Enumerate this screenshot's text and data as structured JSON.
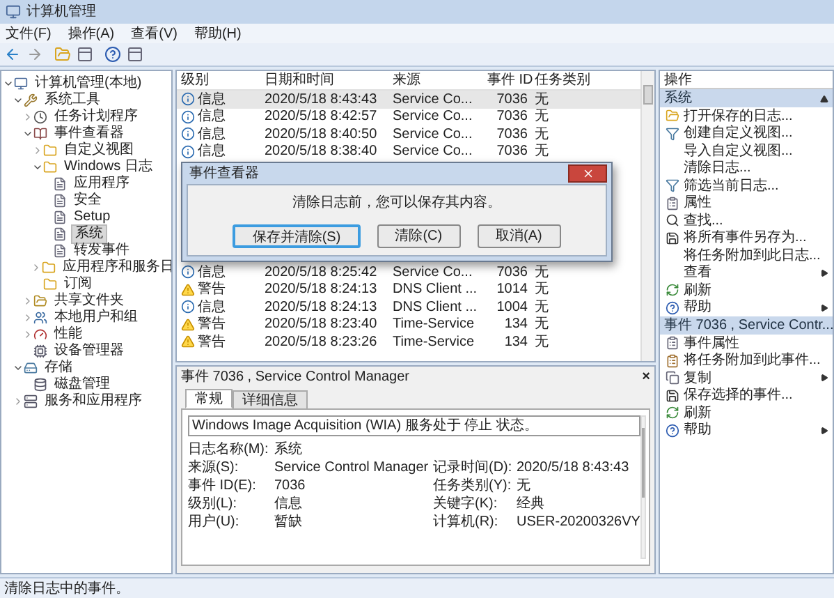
{
  "window": {
    "title": "计算机管理"
  },
  "menu": [
    "文件(F)",
    "操作(A)",
    "查看(V)",
    "帮助(H)"
  ],
  "tree": [
    {
      "label": "计算机管理(本地)",
      "kind": "computer",
      "expanded": true,
      "selected": false,
      "children": [
        {
          "label": "系统工具",
          "kind": "tools",
          "expanded": true,
          "selected": false,
          "children": [
            {
              "label": "任务计划程序",
              "kind": "clock",
              "expanded": false,
              "selected": false
            },
            {
              "label": "事件查看器",
              "kind": "viewer",
              "expanded": true,
              "selected": false,
              "children": [
                {
                  "label": "自定义视图",
                  "kind": "folder",
                  "expanded": false,
                  "selected": false
                },
                {
                  "label": "Windows 日志",
                  "kind": "folder",
                  "expanded": true,
                  "selected": false,
                  "children": [
                    {
                      "label": "应用程序",
                      "kind": "log",
                      "selected": false
                    },
                    {
                      "label": "安全",
                      "kind": "log",
                      "selected": false
                    },
                    {
                      "label": "Setup",
                      "kind": "log",
                      "selected": false
                    },
                    {
                      "label": "系统",
                      "kind": "log",
                      "selected": true
                    },
                    {
                      "label": "转发事件",
                      "kind": "log",
                      "selected": false
                    }
                  ]
                },
                {
                  "label": "应用程序和服务日",
                  "kind": "folder",
                  "expanded": false,
                  "selected": false
                },
                {
                  "label": "订阅",
                  "kind": "folder",
                  "selected": false
                }
              ]
            },
            {
              "label": "共享文件夹",
              "kind": "share",
              "expanded": false,
              "selected": false
            },
            {
              "label": "本地用户和组",
              "kind": "users",
              "expanded": false,
              "selected": false
            },
            {
              "label": "性能",
              "kind": "perf",
              "expanded": false,
              "selected": false
            },
            {
              "label": "设备管理器",
              "kind": "device",
              "selected": false
            }
          ]
        },
        {
          "label": "存储",
          "kind": "storage",
          "expanded": true,
          "selected": false,
          "children": [
            {
              "label": "磁盘管理",
              "kind": "disk",
              "selected": false
            }
          ]
        },
        {
          "label": "服务和应用程序",
          "kind": "services",
          "expanded": false,
          "selected": false
        }
      ]
    }
  ],
  "table": {
    "columns": [
      "级别",
      "日期和时间",
      "来源",
      "事件 ID",
      "任务类别"
    ],
    "rows": [
      {
        "kind": "info",
        "level": "信息",
        "datetime": "2020/5/18 8:43:43",
        "source": "Service Co...",
        "event_id": "7036",
        "task": "无",
        "selected": true
      },
      {
        "kind": "info",
        "level": "信息",
        "datetime": "2020/5/18 8:42:57",
        "source": "Service Co...",
        "event_id": "7036",
        "task": "无",
        "selected": false
      },
      {
        "kind": "info",
        "level": "信息",
        "datetime": "2020/5/18 8:40:50",
        "source": "Service Co...",
        "event_id": "7036",
        "task": "无",
        "selected": false
      },
      {
        "kind": "info",
        "level": "信息",
        "datetime": "2020/5/18 8:38:40",
        "source": "Service Co...",
        "event_id": "7036",
        "task": "无",
        "selected": false
      },
      {
        "kind": "info",
        "level": "信息",
        "datetime": "2020/5/18 8:25:42",
        "source": "Service Co...",
        "event_id": "7036",
        "task": "无",
        "selected": false
      },
      {
        "kind": "warning",
        "level": "警告",
        "datetime": "2020/5/18 8:24:13",
        "source": "DNS Client ...",
        "event_id": "1014",
        "task": "无",
        "selected": false
      },
      {
        "kind": "info",
        "level": "信息",
        "datetime": "2020/5/18 8:24:13",
        "source": "DNS Client ...",
        "event_id": "1004",
        "task": "无",
        "selected": false
      },
      {
        "kind": "warning",
        "level": "警告",
        "datetime": "2020/5/18 8:23:40",
        "source": "Time-Service",
        "event_id": "134",
        "task": "无",
        "selected": false
      },
      {
        "kind": "warning",
        "level": "警告",
        "datetime": "2020/5/18 8:23:26",
        "source": "Time-Service",
        "event_id": "134",
        "task": "无",
        "selected": false
      }
    ]
  },
  "dialog": {
    "title": "事件查看器",
    "message": "清除日志前，您可以保存其内容。",
    "buttons": [
      {
        "label": "保存并清除(S)",
        "default": true
      },
      {
        "label": "清除(C)",
        "default": false
      },
      {
        "label": "取消(A)",
        "default": false
      }
    ]
  },
  "detail": {
    "title": "事件 7036 , Service Control Manager",
    "close": "×",
    "tabs": [
      {
        "label": "常规",
        "selected": true
      },
      {
        "label": "详细信息",
        "selected": false
      }
    ],
    "message": "Windows Image Acquisition (WIA) 服务处于 停止 状态。",
    "fields": [
      [
        {
          "label": "日志名称(M):",
          "value": "系统"
        }
      ],
      [
        {
          "label": "来源(S):",
          "value": "Service Control Manager"
        },
        {
          "label": "记录时间(D):",
          "value": "2020/5/18 8:43:43"
        }
      ],
      [
        {
          "label": "事件 ID(E):",
          "value": "7036"
        },
        {
          "label": "任务类别(Y):",
          "value": "无"
        }
      ],
      [
        {
          "label": "级别(L):",
          "value": "信息"
        },
        {
          "label": "关键字(K):",
          "value": "经典"
        }
      ],
      [
        {
          "label": "用户(U):",
          "value": "暂缺"
        },
        {
          "label": "计算机(R):",
          "value": "USER-20200326VY"
        }
      ]
    ]
  },
  "actions": {
    "title": "操作",
    "sections": [
      {
        "title": "系统",
        "items": [
          {
            "label": "打开保存的日志...",
            "kind": "open",
            "submenu": false
          },
          {
            "label": "创建自定义视图...",
            "kind": "filter",
            "submenu": false
          },
          {
            "label": "导入自定义视图...",
            "kind": "none",
            "submenu": false
          },
          {
            "label": "清除日志...",
            "kind": "none",
            "submenu": false
          },
          {
            "label": "筛选当前日志...",
            "kind": "filter",
            "submenu": false
          },
          {
            "label": "属性",
            "kind": "props",
            "submenu": false
          },
          {
            "label": "查找...",
            "kind": "find",
            "submenu": false
          },
          {
            "label": "将所有事件另存为...",
            "kind": "save",
            "submenu": false
          },
          {
            "label": "将任务附加到此日志...",
            "kind": "none",
            "submenu": false
          },
          {
            "label": "查看",
            "kind": "none",
            "submenu": true
          },
          {
            "label": "刷新",
            "kind": "refresh",
            "submenu": false
          },
          {
            "label": "帮助",
            "kind": "help",
            "submenu": true
          }
        ]
      },
      {
        "title": "事件 7036 , Service Contr...",
        "items": [
          {
            "label": "事件属性",
            "kind": "props",
            "submenu": false
          },
          {
            "label": "将任务附加到此事件...",
            "kind": "task",
            "submenu": false
          },
          {
            "label": "复制",
            "kind": "copy",
            "submenu": true
          },
          {
            "label": "保存选择的事件...",
            "kind": "save",
            "submenu": false
          },
          {
            "label": "刷新",
            "kind": "refresh",
            "submenu": false
          },
          {
            "label": "帮助",
            "kind": "help",
            "submenu": true
          }
        ]
      }
    ]
  },
  "status_bar": "清除日志中的事件。"
}
